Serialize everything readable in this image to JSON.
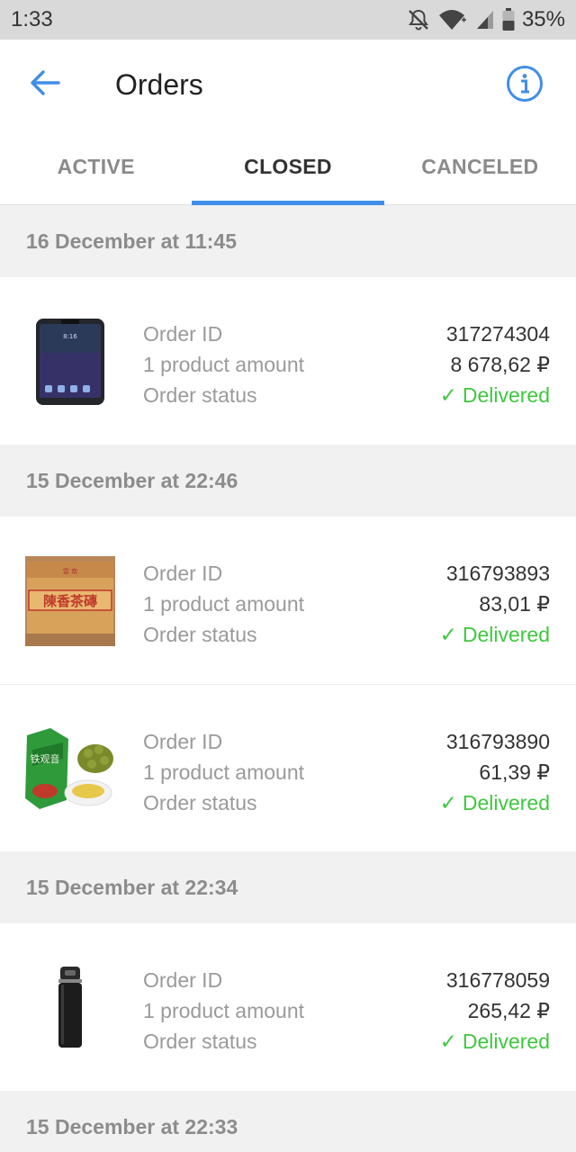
{
  "status_bar": {
    "time": "1:33",
    "battery": "35%"
  },
  "header": {
    "title": "Orders"
  },
  "tabs": [
    {
      "label": "ACTIVE"
    },
    {
      "label": "CLOSED"
    },
    {
      "label": "CANCELED"
    }
  ],
  "labels": {
    "order_id": "Order ID",
    "amount": "1 product amount",
    "status": "Order status"
  },
  "groups": [
    {
      "date": "16 December at 11:45",
      "orders": [
        {
          "id": "317274304",
          "amount": "8 678,62 ₽",
          "status": "Delivered",
          "check": "✓",
          "image": "smartphone-image"
        }
      ]
    },
    {
      "date": "15 December at 22:46",
      "orders": [
        {
          "id": "316793893",
          "amount": "83,01 ₽",
          "status": "Delivered",
          "check": "✓",
          "image": "tea-brick-image"
        },
        {
          "id": "316793890",
          "amount": "61,39 ₽",
          "status": "Delivered",
          "check": "✓",
          "image": "oolong-tea-image"
        }
      ]
    },
    {
      "date": "15 December at 22:34",
      "orders": [
        {
          "id": "316778059",
          "amount": "265,42 ₽",
          "status": "Delivered",
          "check": "✓",
          "image": "thermos-image"
        }
      ]
    },
    {
      "date": "15 December at 22:33",
      "orders": []
    }
  ],
  "colors": {
    "accent": "#3f8ee8",
    "delivered": "#3fc73f",
    "status_bar": "#d9d9d9"
  }
}
